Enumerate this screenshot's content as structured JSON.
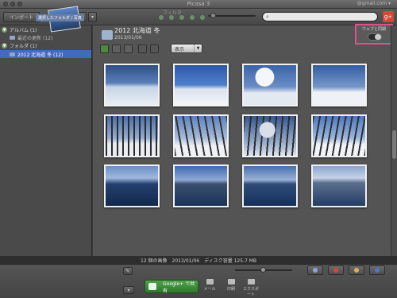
{
  "window": {
    "title": "Picasa 3",
    "account": "@gmail.com ▾"
  },
  "toolbar": {
    "import_label": "インポート",
    "filter_label": "フィルタ",
    "search_placeholder": ""
  },
  "sidebar": {
    "albums_header": "アルバム (1)",
    "recent_item": "最近の更新 (12)",
    "folders_header": "フォルダ (1)",
    "folder_item": "2012 北海道 冬 (12)"
  },
  "main": {
    "album_title": "2012 北海道 冬",
    "album_date": "2013/01/06",
    "web_sync_label": "ウェブと同期",
    "order_label": "表示",
    "thumbnails": [
      {
        "name": "snow-field-1"
      },
      {
        "name": "snow-field-2"
      },
      {
        "name": "mountain-cloud-1"
      },
      {
        "name": "mountain-cloud-2"
      },
      {
        "name": "winter-trees-1"
      },
      {
        "name": "winter-trees-2"
      },
      {
        "name": "winter-trees-3"
      },
      {
        "name": "winter-trees-4"
      },
      {
        "name": "lake-1"
      },
      {
        "name": "lake-2"
      },
      {
        "name": "lake-3"
      },
      {
        "name": "lake-4"
      }
    ]
  },
  "status": {
    "text": "12 個の画像　2013/01/06　ディスク容量 125.7 MB"
  },
  "tray": {
    "selection_label": "選択したフォルダ / 写真",
    "share_label": "Google+ で共有",
    "tools": [
      {
        "label": "メール"
      },
      {
        "label": "印刷"
      },
      {
        "label": "エクスポート"
      }
    ]
  },
  "colors": {
    "selection": "#3f6dbd",
    "share": "#3c8d38",
    "highlight": "#e0508a"
  }
}
